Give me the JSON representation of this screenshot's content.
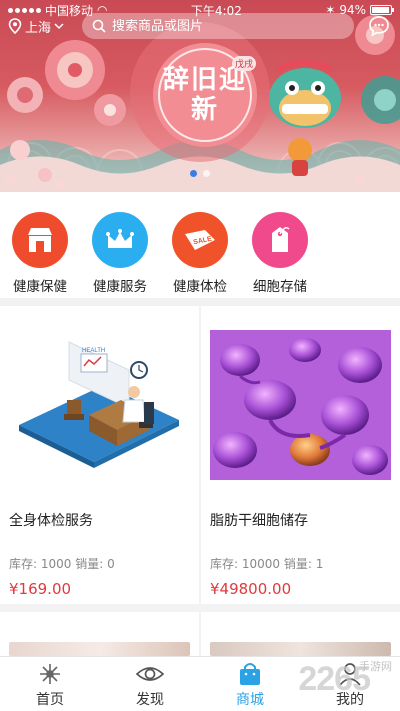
{
  "status_bar": {
    "carrier": "中国移动",
    "time": "下午4:02",
    "battery": "94%",
    "battery_level": 0.94
  },
  "header": {
    "city": "上海",
    "search_placeholder": "搜索商品或图片",
    "message_icon": "chat-bubble-icon"
  },
  "banner": {
    "seal_main": "辞旧迎新",
    "seal_small": "戊戌",
    "slide_count": 2,
    "active_slide": 1,
    "dot_active_color": "#3b7de0"
  },
  "categories": [
    {
      "label": "健康保健",
      "icon": "store-icon",
      "color": "#ef4c2e"
    },
    {
      "label": "健康服务",
      "icon": "crown-icon",
      "color": "#2aaef0"
    },
    {
      "label": "健康体检",
      "icon": "sale-tag-icon",
      "color": "#f0532a"
    },
    {
      "label": "细胞存储",
      "icon": "gift-tag-icon",
      "color": "#f04a8c"
    }
  ],
  "products": [
    {
      "name": "全身体检服务",
      "stock_label": "库存:",
      "stock": "1000",
      "sales_label": "销量:",
      "sales": "0",
      "price": "¥169.00",
      "image_icon": "health-office-illustration-icon"
    },
    {
      "name": "脂肪干细胞储存",
      "stock_label": "库存:",
      "stock": "10000",
      "sales_label": "销量:",
      "sales": "1",
      "price": "¥49800.00",
      "image_icon": "cells-microscope-icon"
    }
  ],
  "tabbar": [
    {
      "label": "首页",
      "icon": "home-flower-icon",
      "active": false
    },
    {
      "label": "发现",
      "icon": "eye-icon",
      "active": false
    },
    {
      "label": "商城",
      "icon": "shopping-bag-icon",
      "active": true
    },
    {
      "label": "我的",
      "icon": "user-icon",
      "active": false
    }
  ],
  "watermark": {
    "text": "2265",
    "sub": "手游网"
  },
  "colors": {
    "accent": "#2aa3e6",
    "price": "#e0393e",
    "banner_red": "#c94a55"
  }
}
